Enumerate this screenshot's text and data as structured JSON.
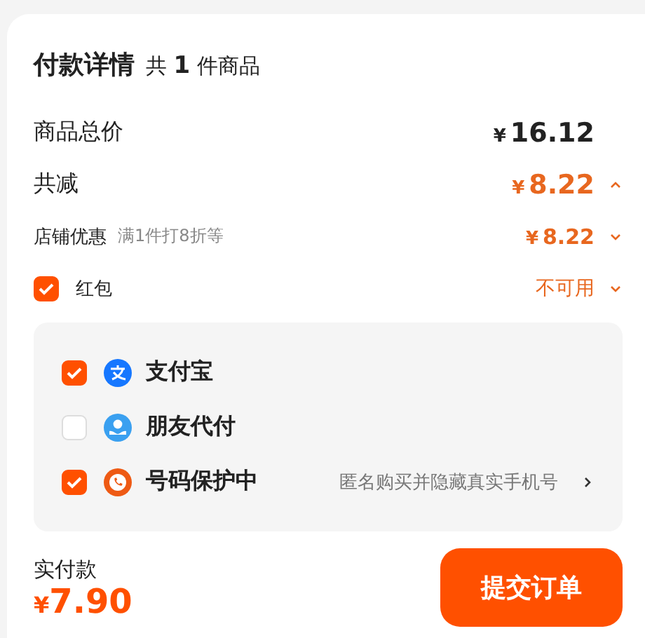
{
  "header": {
    "title": "付款详情",
    "count": "共 **1** 件商品"
  },
  "rows": [
    {
      "kind": "total",
      "label": "商品总价",
      "currency": "¥",
      "amount": "16.12"
    },
    {
      "kind": "discount",
      "label": "共减",
      "currency": "¥",
      "amount": "8.22",
      "expanded": true
    },
    {
      "kind": "store",
      "label": "店铺优惠",
      "note": "满1件打8折等",
      "currency": "¥",
      "amount": "8.22",
      "expanded": false
    },
    {
      "kind": "check",
      "label": "红包",
      "checked": true,
      "status": "不可用",
      "expanded": false
    }
  ],
  "options": [
    {
      "kind": "alipay",
      "label": "支付宝",
      "checked": true
    },
    {
      "kind": "friend",
      "label": "朋友代付",
      "checked": false
    },
    {
      "kind": "phone",
      "label": "号码保护中",
      "checked": true,
      "note": "匿名购买并隐藏真实手机号"
    }
  ],
  "footer": {
    "label": "实付款",
    "currency": "¥",
    "amount": "7.90",
    "button": "提交订单"
  }
}
